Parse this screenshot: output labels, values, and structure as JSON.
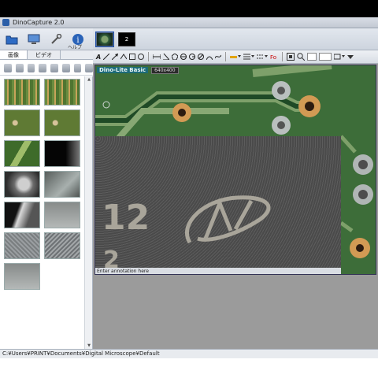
{
  "window": {
    "title": "DinoCapture 2.0"
  },
  "main_toolbar": {
    "help_label": "ヘルプ"
  },
  "capture_strip": {
    "second_camera_label": "2"
  },
  "tabs": [
    {
      "label": "画像",
      "active": true
    },
    {
      "label": "ビデオ",
      "active": false
    }
  ],
  "draw_toolbar": {
    "text_tool": "A",
    "zoom_value": ""
  },
  "thumbnails": [
    {
      "kind": "t-pcb"
    },
    {
      "kind": "t-pcb"
    },
    {
      "kind": "t-pcb2"
    },
    {
      "kind": "t-pcb2"
    },
    {
      "kind": "t-pcb3"
    },
    {
      "kind": "t-dark"
    },
    {
      "kind": "t-blur"
    },
    {
      "kind": "t-blur2"
    },
    {
      "kind": "t-blur3"
    },
    {
      "kind": "t-grey"
    },
    {
      "kind": "t-mesh"
    },
    {
      "kind": "t-mesh2"
    },
    {
      "kind": "t-grey"
    }
  ],
  "preview": {
    "device_name": "Dino-Lite Basic",
    "resolution": "640x400",
    "chip_marking_1": "12",
    "chip_marking_2": "2",
    "annotation_placeholder": "Enter annotation here"
  },
  "statusbar": {
    "path": "C:¥Users¥PRINT¥Documents¥Digital Microscope¥Default"
  }
}
